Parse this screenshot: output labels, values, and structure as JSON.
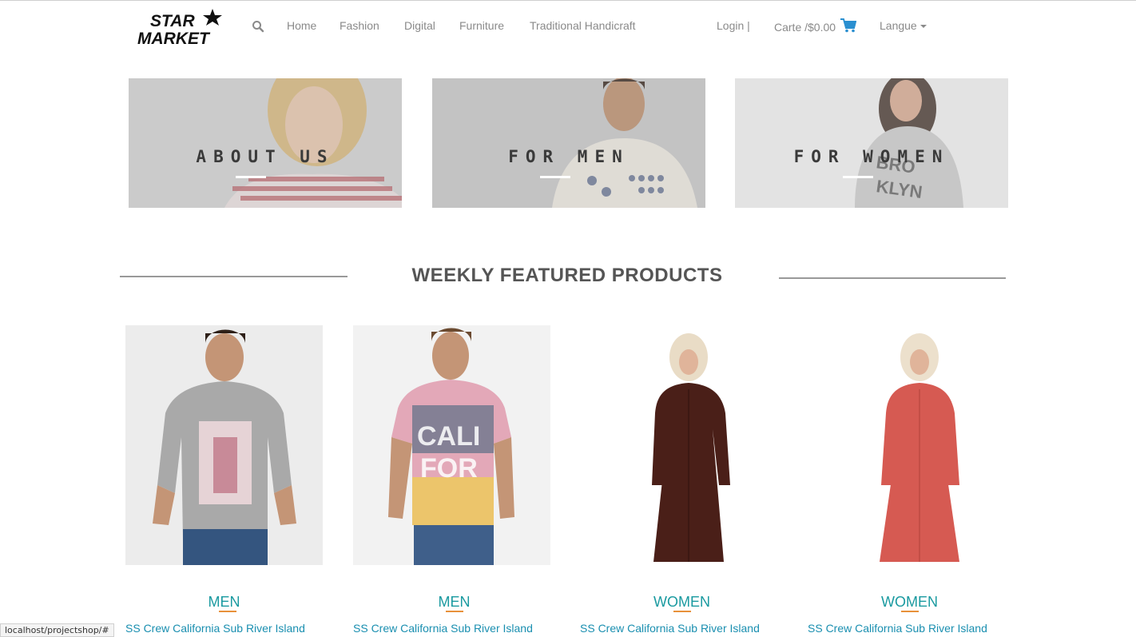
{
  "brand": {
    "logo_line1": "STAR",
    "logo_line2": "MARKET"
  },
  "nav": {
    "links": [
      "Home",
      "Fashion",
      "Digital",
      "Furniture",
      "Traditional Handicraft"
    ],
    "login": "Login |",
    "cart": "Carte /$0.00",
    "language": "Langue"
  },
  "banners": [
    {
      "title": "ABOUT US"
    },
    {
      "title": "FOR MEN"
    },
    {
      "title": "FOR WOMEN"
    }
  ],
  "featured": {
    "title": "WEEKLY FEATURED PRODUCTS",
    "products": [
      {
        "category": "MEN",
        "name": "SS Crew California Sub River Island"
      },
      {
        "category": "MEN",
        "name": "SS Crew California Sub River Island"
      },
      {
        "category": "WOMEN",
        "name": "SS Crew California Sub River Island"
      },
      {
        "category": "WOMEN",
        "name": "SS Crew California Sub River Island"
      }
    ]
  },
  "status_bar": {
    "url": "localhost/projectshop/#"
  },
  "colors": {
    "accent": "#1a9aa0",
    "link": "#1a8fb0",
    "underline": "#e8913a",
    "cart_icon": "#2a8fd0"
  }
}
